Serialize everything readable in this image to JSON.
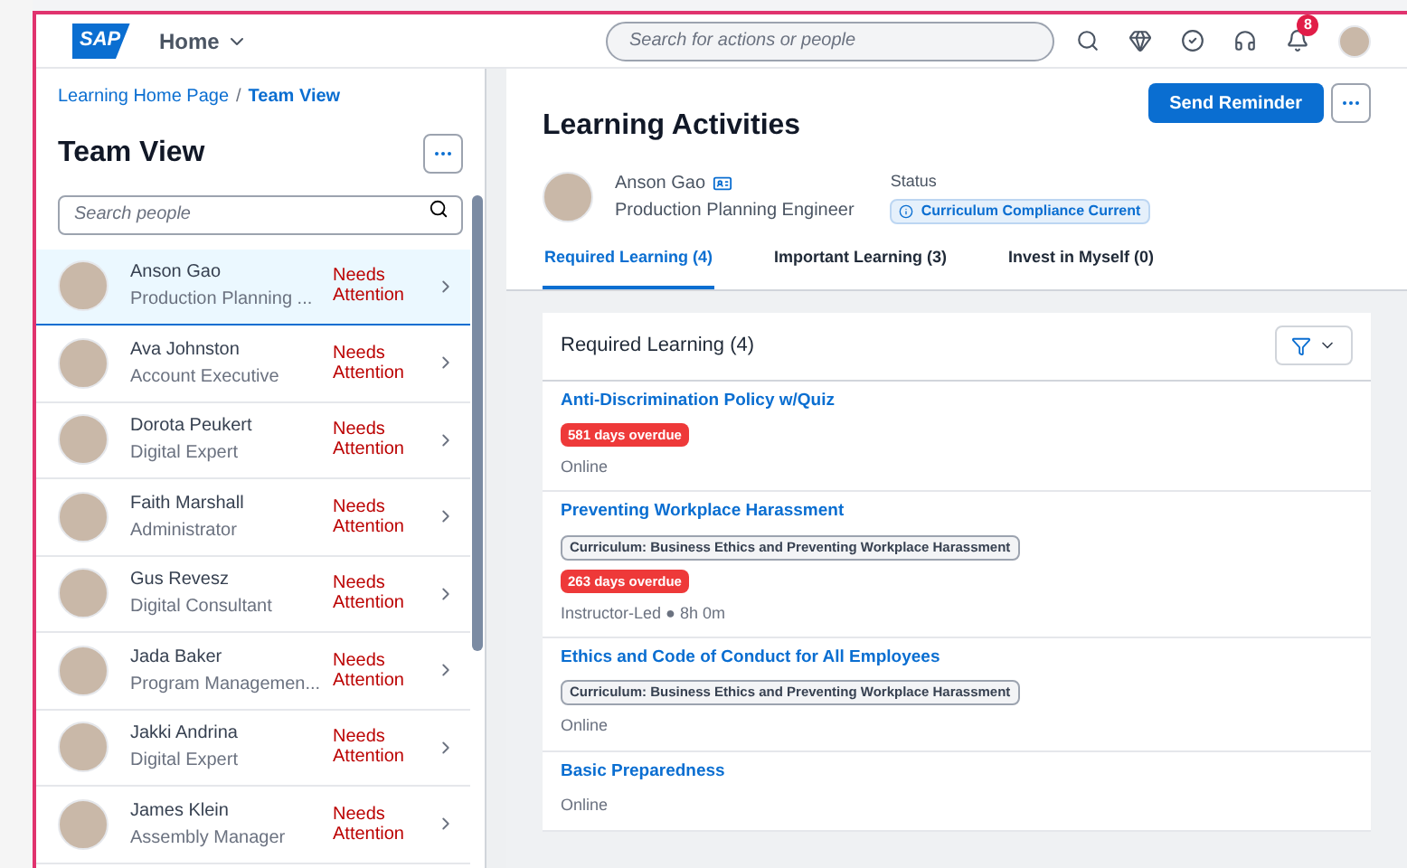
{
  "shell": {
    "logo": "SAP",
    "home_menu": "Home",
    "search": {
      "placeholder": "Search for actions or people"
    },
    "notification_count": "8"
  },
  "breadcrumb": {
    "separator": "/",
    "items": [
      {
        "label": "Learning Home Page",
        "current": false
      },
      {
        "label": "Team View",
        "current": true
      }
    ]
  },
  "team_panel": {
    "title": "Team View",
    "search": {
      "placeholder": "Search people"
    },
    "people": [
      {
        "name": "Anson Gao",
        "role": "Production Planning ...",
        "status": "Needs Attention",
        "selected": true
      },
      {
        "name": "Ava Johnston",
        "role": "Account Executive",
        "status": "Needs Attention",
        "selected": false
      },
      {
        "name": "Dorota Peukert",
        "role": "Digital Expert",
        "status": "Needs Attention",
        "selected": false
      },
      {
        "name": "Faith Marshall",
        "role": "Administrator",
        "status": "Needs Attention",
        "selected": false
      },
      {
        "name": "Gus Revesz",
        "role": "Digital Consultant",
        "status": "Needs Attention",
        "selected": false
      },
      {
        "name": "Jada Baker",
        "role": "Program Managemen...",
        "status": "Needs Attention",
        "selected": false
      },
      {
        "name": "Jakki Andrina",
        "role": "Digital Expert",
        "status": "Needs Attention",
        "selected": false
      },
      {
        "name": "James Klein",
        "role": "Assembly Manager",
        "status": "Needs Attention",
        "selected": false
      }
    ]
  },
  "detail": {
    "title": "Learning Activities",
    "primary_button": "Send Reminder",
    "person": {
      "name": "Anson Gao",
      "role": "Production Planning Engineer"
    },
    "status": {
      "label": "Status",
      "value": "Curriculum Compliance Current"
    },
    "tabs": [
      {
        "label": "Required Learning (4)",
        "selected": true
      },
      {
        "label": "Important Learning (3)",
        "selected": false
      },
      {
        "label": "Invest in Myself (0)",
        "selected": false
      }
    ],
    "list": {
      "title": "Required Learning (4)",
      "items": [
        {
          "title": "Anti-Discrimination Policy w/Quiz",
          "overdue": "581 days overdue",
          "meta": "Online"
        },
        {
          "title": "Preventing Workplace Harassment",
          "curriculum": "Curriculum: Business Ethics and Preventing Workplace Harassment",
          "overdue": "263 days overdue",
          "meta": "Instructor-Led ● 8h 0m"
        },
        {
          "title": "Ethics and Code of Conduct for All Employees",
          "curriculum": "Curriculum: Business Ethics and Preventing Workplace Harassment",
          "meta": "Online"
        },
        {
          "title": "Basic Preparedness",
          "meta": "Online"
        }
      ]
    }
  }
}
